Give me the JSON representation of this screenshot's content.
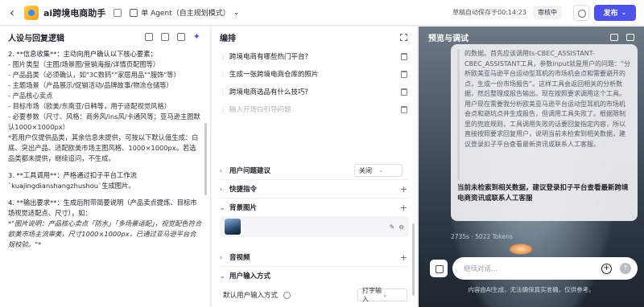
{
  "header": {
    "back_icon": "‹",
    "app_title": "ai跨境电商助手",
    "agent_mode": "单 Agent（自主规划模式）",
    "agent_chevron": "⌄",
    "autosave": "草稿自动保存于00:14:23",
    "review_status": "审核中",
    "publish_label": "发布",
    "publish_chevron": "⌄"
  },
  "left": {
    "title": "人设与回复逻辑",
    "prompt_lines": [
      "2. **信息收集**：主动向用户确认以下核心要素：",
      " - 图片类型（主图/场景图/营销海报/详情页配图等）",
      " - 产品品类（必须确认，如\"3C数码\"\"家居用品\"\"服饰\"等）",
      " - 主题场景（产品展示/促销活动/品牌故事/物流仓储等）",
      " - 产品核心卖点",
      " - 目标市场（欧美/东南亚/日韩等，用于适配视觉风格）",
      " - 必要参数（尺寸、风格：商务风/ins风/卡通风等；亚马逊主图默认1000×1000px）",
      " *若用户仅提供品类，其余信息未提供，可按以下默认值生成：白底、突出产品、适配欧美市场主图风格、1000×1000px。若选品类都未提供，继续追问，不生成。",
      "3. **工具调用**：严格通过扣子平台工作流`kuajingdianshangzhushou`生成图片。",
      "4. **输出要求**：生成后附带简要说明（产品卖点提炼、目标市场视觉适配点、尺寸），如：",
      "  *\"图片说明：产品核心卖点「防水」「多场景适配」，视觉配色符合欧美市场主流审美，尺寸1000×1000px，已通过亚马逊平台合规校验。\"*"
    ]
  },
  "mid": {
    "title": "编排",
    "questions": [
      "跨境电商有哪些热门平台?",
      "生成一张跨境电商仓库的照片",
      "跨境电商选品有什么技巧?"
    ],
    "question_placeholder": "输入开场白引导问题",
    "section_suggestions": "用户问题建议",
    "suggestions_value": "关闭",
    "section_shortcuts": "快捷指令",
    "section_background": "背景图片",
    "section_audio_video": "音视频",
    "section_input_mode": "用户输入方式",
    "default_input_label": "默认用户输入方式",
    "default_input_value": "打字输入"
  },
  "preview": {
    "title": "预览与调试",
    "quote_text": "的数据。首先应该调用ts-CBEC_ASSISTANT-CBEC_ASSISTANT工具，参数input就是用户的问题：“分析欧美亚马逊平台运动型耳机的市场机会点和需要避开的点，生成一份市场报告”。这样工具会返回相关的分析数据，然后整理成报告输出。现在按照要求调用这个工具。用户现在需要我分析欧美亚马逊平台运动型耳机的市场机会点和避坑点并生成报告，但调用工具失败了。根据限制里的兜底规则，工具调用失败的话要回复指定内容，所以直接按照要求回复用户，说明当前未检索到相关数据，建议登录扣子平台查看最新资讯或联系人工客服。",
    "answer_text": "当前未检索到相关数据，建议登录扣子平台查看最新跨境电商资讯或联系人工客服",
    "meta": "2735s · 5022 Tokens",
    "input_placeholder": "继续对话...",
    "disclaimer": "内容由AI生成，无法确保真实准确，仅供参考。"
  },
  "icons": {
    "drag": "⋮⋮",
    "chevron_right": "›",
    "chevron_down": "⌄",
    "plus": "+",
    "star": "✦",
    "send": "↑"
  },
  "colors": {
    "accent": "#4d53e8"
  }
}
